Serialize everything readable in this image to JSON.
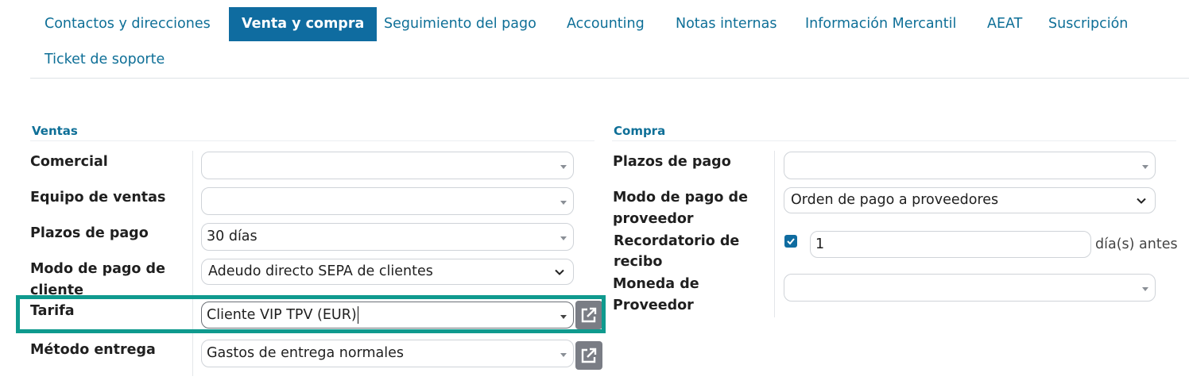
{
  "tabs": [
    {
      "label": "Contactos y direcciones",
      "active": false
    },
    {
      "label": "Venta y compra",
      "active": true
    },
    {
      "label": "Seguimiento del pago",
      "active": false
    },
    {
      "label": "Accounting",
      "active": false
    },
    {
      "label": "Notas internas",
      "active": false
    },
    {
      "label": "Información Mercantil",
      "active": false
    },
    {
      "label": "AEAT",
      "active": false
    },
    {
      "label": "Suscripción",
      "active": false
    },
    {
      "label": "Ticket de soporte",
      "active": false
    }
  ],
  "ventas": {
    "title": "Ventas",
    "comercial": {
      "label": "Comercial",
      "value": ""
    },
    "equipo": {
      "label": "Equipo de ventas",
      "value": ""
    },
    "plazos": {
      "label": "Plazos de pago",
      "value": "30 días"
    },
    "modo_pago": {
      "label": "Modo de pago de cliente",
      "value": "Adeudo directo SEPA de clientes"
    },
    "tarifa": {
      "label": "Tarifa",
      "value": "Cliente VIP TPV (EUR)"
    },
    "metodo_entrega": {
      "label": "Método entrega",
      "value": "Gastos de entrega normales"
    }
  },
  "compra": {
    "title": "Compra",
    "plazos": {
      "label": "Plazos de pago",
      "value": ""
    },
    "modo_pago": {
      "label": "Modo de pago de proveedor",
      "value": "Orden de pago a proveedores"
    },
    "recordatorio": {
      "label": "Recordatorio de recibo",
      "checked": true,
      "value": "1",
      "suffix": "día(s) antes"
    },
    "moneda": {
      "label": "Moneda de Proveedor",
      "value": ""
    }
  },
  "colors": {
    "accent": "#0f6ca0",
    "highlight": "#0f9a8e"
  },
  "icons": [
    "external-link-icon",
    "dropdown-caret-icon",
    "chevron-down-icon",
    "checkmark-icon"
  ]
}
